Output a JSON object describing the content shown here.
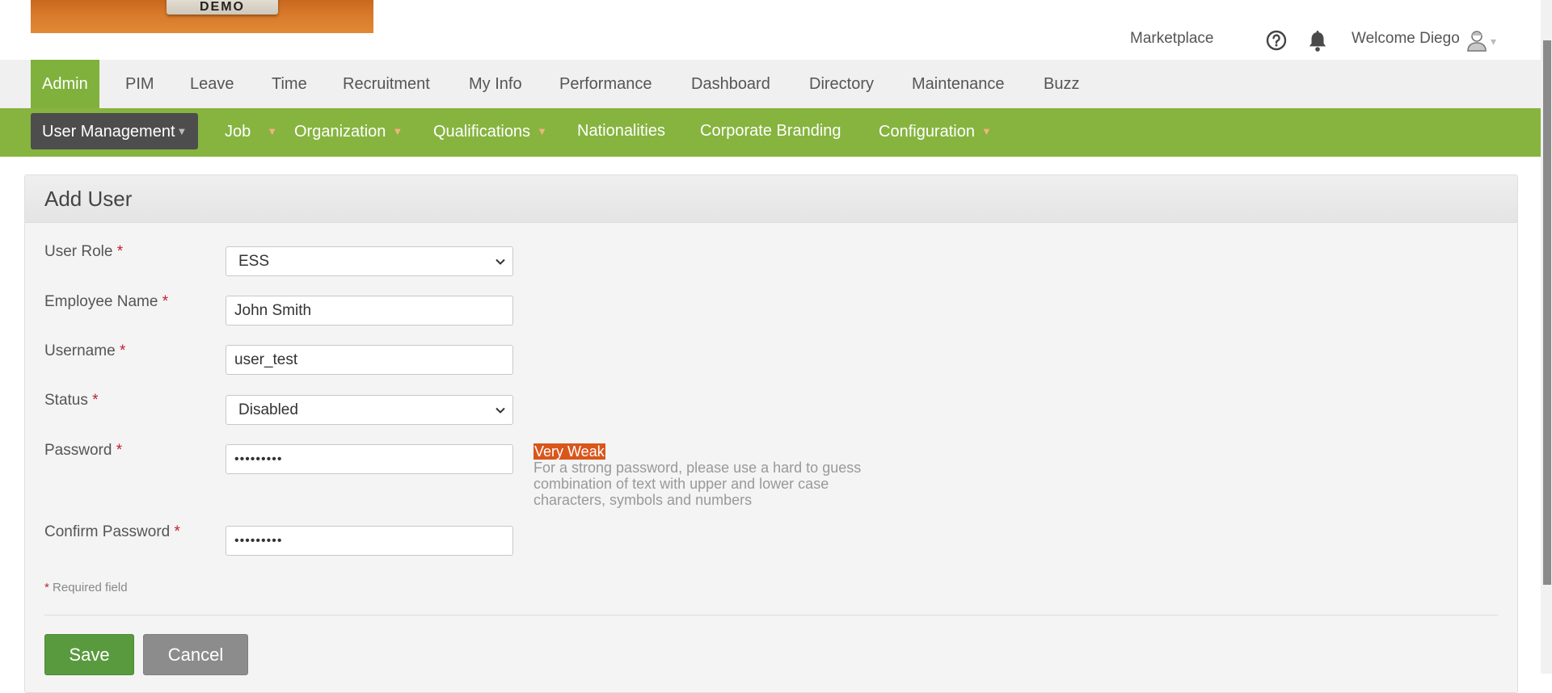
{
  "header": {
    "logo_text": "DEMO",
    "marketplace": "Marketplace",
    "welcome": "Welcome Diego"
  },
  "main_menu": {
    "items": [
      "Admin",
      "PIM",
      "Leave",
      "Time",
      "Recruitment",
      "My Info",
      "Performance",
      "Dashboard",
      "Directory",
      "Maintenance",
      "Buzz"
    ],
    "active": "Admin"
  },
  "sub_menu": {
    "items": [
      "User Management",
      "Job",
      "Organization",
      "Qualifications",
      "Nationalities",
      "Corporate Branding",
      "Configuration"
    ],
    "active": "User Management"
  },
  "form": {
    "title": "Add User",
    "user_role": {
      "label": "User Role",
      "value": "ESS"
    },
    "employee_name": {
      "label": "Employee Name",
      "value": "John Smith"
    },
    "username": {
      "label": "Username",
      "value": "user_test"
    },
    "status": {
      "label": "Status",
      "value": "Disabled"
    },
    "password": {
      "label": "Password",
      "value": "•••••••••"
    },
    "confirm_password": {
      "label": "Confirm Password",
      "value": "•••••••••"
    },
    "required_marker": "*",
    "strength": "Very Weak",
    "password_hint": "For a strong password, please use a hard to guess combination of text with upper and lower case characters, symbols and numbers",
    "required_note": "Required field",
    "save_label": "Save",
    "cancel_label": "Cancel"
  },
  "colors": {
    "accent_green": "#86b43f",
    "active_tab": "#7fb13c",
    "submenu_active": "#4d4d4d",
    "strength_badge": "#d9561c",
    "save_button": "#5a9a3e",
    "cancel_button": "#8c8c8c"
  },
  "icons": {
    "help": "question-circle",
    "notifications": "bell",
    "user": "user-avatar",
    "dropdown": "chevron-down"
  }
}
